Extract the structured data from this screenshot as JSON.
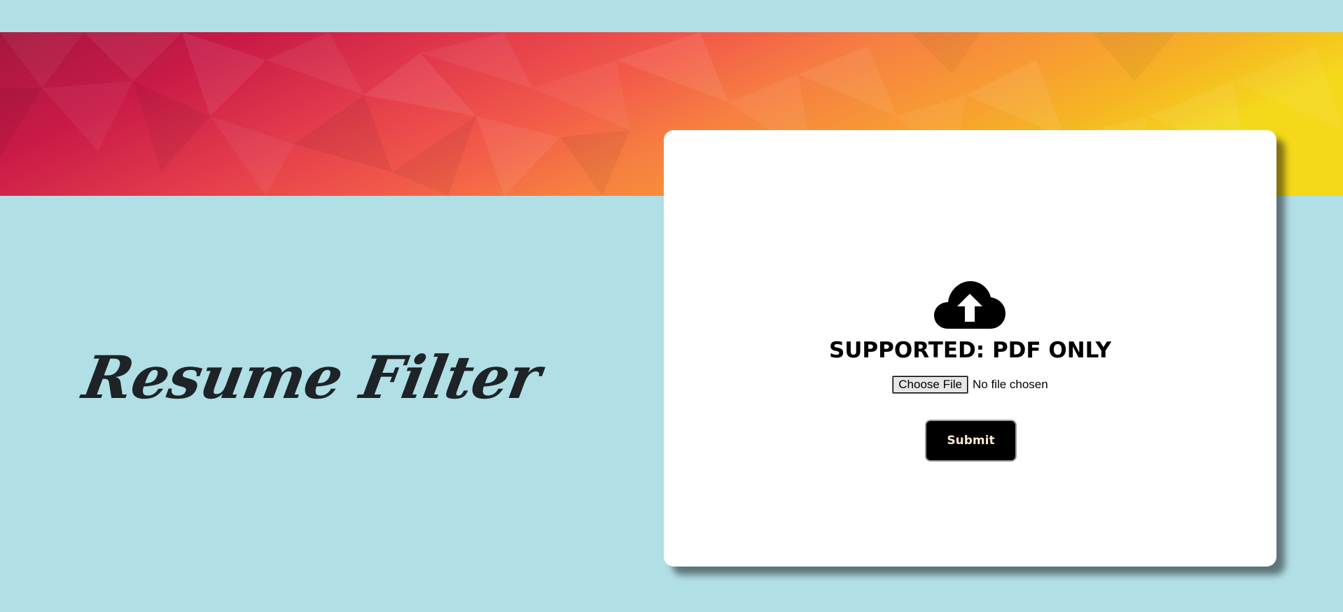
{
  "page": {
    "background_color": "#b0dfe5"
  },
  "banner": {
    "style": "low-poly gradient",
    "colors": [
      "#a5173f",
      "#c91a47",
      "#e43d4c",
      "#f25a49",
      "#f67d42",
      "#f79a34",
      "#f6b523",
      "#f4d91b"
    ]
  },
  "brand": {
    "title": "Resume Filter",
    "color": "#1d2326"
  },
  "upload_card": {
    "icon": "cloud-upload-icon",
    "supported_text": "SUPPORTED: PDF ONLY",
    "file_input": {
      "button_label": "Choose File",
      "status_text": "No file chosen"
    },
    "submit_label": "Submit",
    "submit_text_color": "#fde9cf"
  }
}
